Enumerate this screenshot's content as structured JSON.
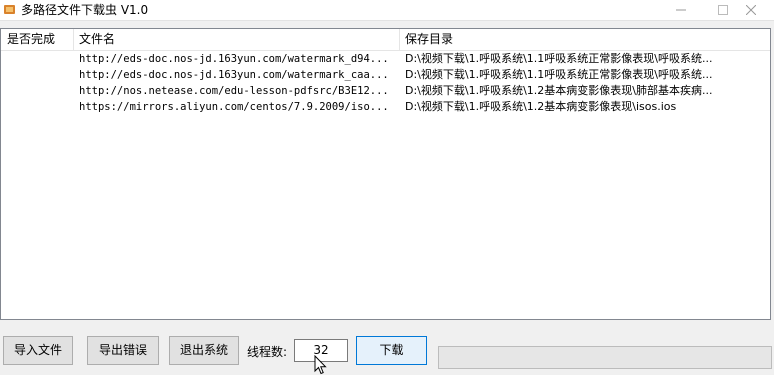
{
  "window": {
    "title": "多路径文件下载虫 V1.0"
  },
  "table": {
    "columns": [
      "是否完成",
      "文件名",
      "保存目录"
    ],
    "rows": [
      {
        "done": "",
        "name": "http://eds-doc.nos-jd.163yun.com/watermark_d94...",
        "dir": "D:\\视频下载\\1.呼吸系统\\1.1呼吸系统正常影像表现\\呼吸系统..."
      },
      {
        "done": "",
        "name": "http://eds-doc.nos-jd.163yun.com/watermark_caa...",
        "dir": "D:\\视频下载\\1.呼吸系统\\1.1呼吸系统正常影像表现\\呼吸系统..."
      },
      {
        "done": "",
        "name": "http://nos.netease.com/edu-lesson-pdfsrc/B3E12...",
        "dir": "D:\\视频下载\\1.呼吸系统\\1.2基本病变影像表现\\肺部基本疾病..."
      },
      {
        "done": "",
        "name": "https://mirrors.aliyun.com/centos/7.9.2009/iso...",
        "dir": "D:\\视频下载\\1.呼吸系统\\1.2基本病变影像表现\\isos.ios"
      }
    ]
  },
  "toolbar": {
    "import_label": "导入文件",
    "export_label": "导出错误",
    "exit_label": "退出系统",
    "threads_label": "线程数:",
    "threads_value": "32",
    "download_label": "下载"
  },
  "progress": {
    "value": 0
  },
  "colors": {
    "accent": "#0078d7",
    "progress_fill": "#06b025"
  },
  "icons": {
    "app": "app-icon",
    "minimize": "minimize-icon",
    "maximize": "maximize-icon",
    "close": "close-icon"
  }
}
